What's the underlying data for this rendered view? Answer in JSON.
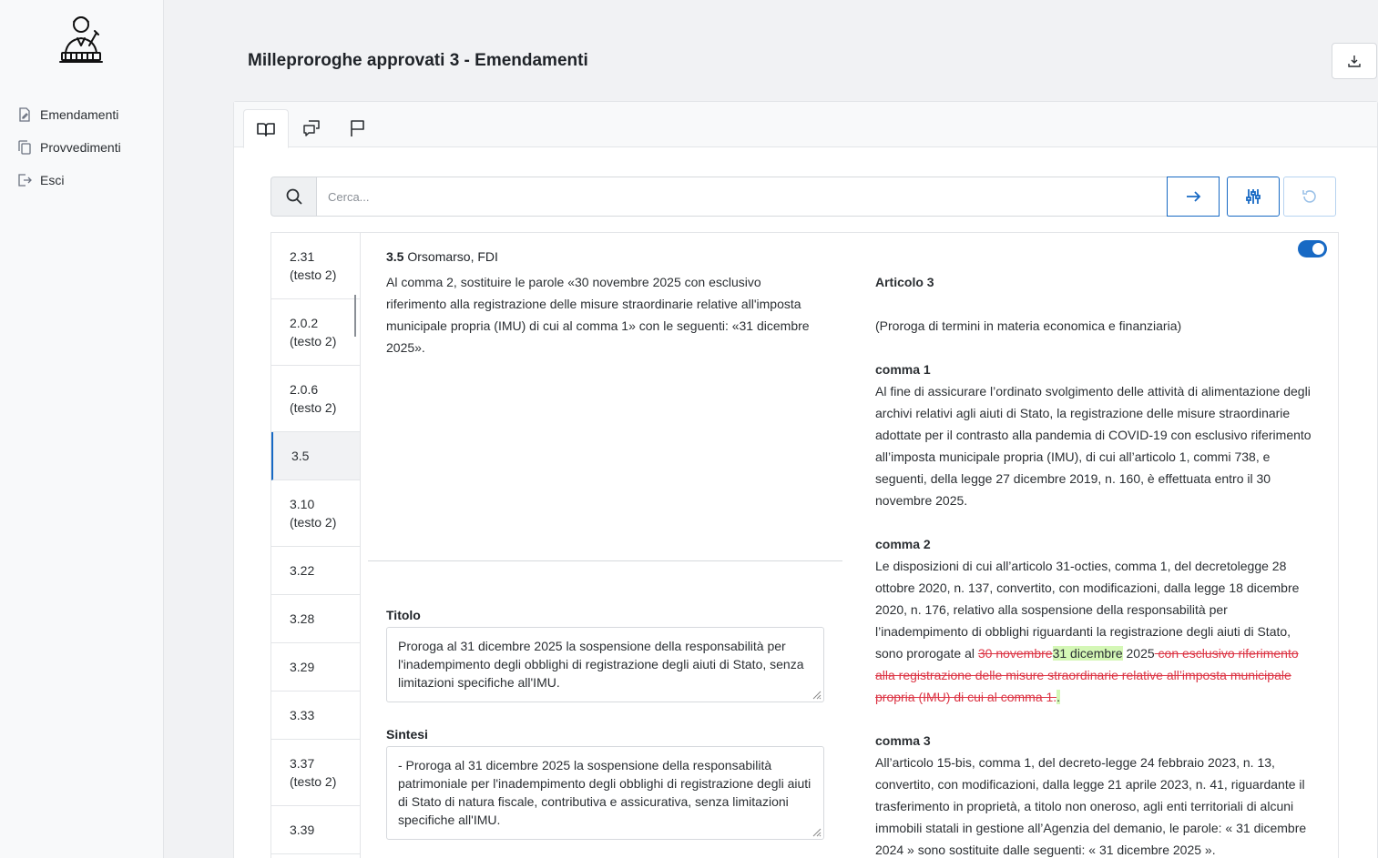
{
  "sidebar": {
    "items": [
      {
        "label": "Emendamenti",
        "icon": "document-edit-icon"
      },
      {
        "label": "Provvedimenti",
        "icon": "documents-copy-icon"
      },
      {
        "label": "Esci",
        "icon": "logout-icon"
      }
    ]
  },
  "header": {
    "title": "Milleproroghe approvati 3 - Emendamenti"
  },
  "tabs": [
    {
      "icon": "book-open-icon",
      "active": true
    },
    {
      "icon": "chat-bubbles-icon",
      "active": false
    },
    {
      "icon": "flag-icon",
      "active": false
    }
  ],
  "search": {
    "placeholder": "Cerca...",
    "value": ""
  },
  "amendments": [
    {
      "code": "2.31",
      "note": "(testo 2)"
    },
    {
      "code": "2.0.2",
      "note": "(testo 2)"
    },
    {
      "code": "2.0.6",
      "note": "(testo 2)"
    },
    {
      "code": "3.5",
      "note": ""
    },
    {
      "code": "3.10",
      "note": "(testo 2)"
    },
    {
      "code": "3.22",
      "note": ""
    },
    {
      "code": "3.28",
      "note": ""
    },
    {
      "code": "3.29",
      "note": ""
    },
    {
      "code": "3.33",
      "note": ""
    },
    {
      "code": "3.37",
      "note": "(testo 2)"
    },
    {
      "code": "3.39",
      "note": ""
    }
  ],
  "selected": {
    "code": "3.5",
    "author": "Orsomarso, FDI",
    "text": "Al comma 2, sostituire le parole «30 novembre 2025 con esclusivo riferimento alla registrazione delle misure straordinarie relative all'imposta municipale propria (IMU) di cui al comma 1» con le seguenti: «31 dicembre 2025».",
    "titolo_label": "Titolo",
    "titolo": "Proroga al 31 dicembre 2025 la sospensione della responsabilità per l'inadempimento degli obblighi di registrazione degli aiuti di Stato, senza limitazioni specifiche all'IMU.",
    "sintesi_label": "Sintesi",
    "sintesi": "- Proroga al 31 dicembre 2025 la sospensione della responsabilità patrimoniale per l'inadempimento degli obblighi di registrazione degli aiuti di Stato di natura fiscale, contributiva e assicurativa, senza limitazioni specifiche all'IMU.",
    "toggle_on": true
  },
  "article": {
    "title": "Articolo 3",
    "subtitle": "(Proroga di termini in materia economica e finanziaria)",
    "comma1_label": "comma 1",
    "comma1": "Al fine di assicurare l’ordinato svolgimento delle attività di alimentazione degli archivi relativi agli aiuti di Stato, la registrazione delle misure straordinarie adottate per il contrasto alla pandemia di COVID-19 con esclusivo riferimento all’imposta municipale propria (IMU), di cui all’articolo 1, commi 738, e seguenti, della legge 27 dicembre 2019, n. 160, è effettuata entro il 30 novembre 2025.",
    "comma2_label": "comma 2",
    "comma2_a": "Le disposizioni di cui all’articolo 31-octies, comma 1, del decretolegge 28 ottobre 2020, n. 137, convertito, con modificazioni, dalla legge 18 dicembre 2020, n. 176, relativo alla sospensione della responsabilità per l’inadempimento di obblighi riguardanti la registrazione degli aiuti di Stato, sono prorogate al ",
    "comma2_del1": "30 novembre",
    "comma2_ins1": "31 dicembre",
    "comma2_b": " 2025",
    "comma2_del2": " con esclusivo riferimento alla registrazione delle misure straordinarie relative all’imposta municipale propria (IMU) di cui al comma 1.",
    "comma2_ins2": ".",
    "comma3_label": "comma 3",
    "comma3": "All’articolo 15-bis, comma 1, del decreto-legge 24 febbraio 2023, n. 13, convertito, con modificazioni, dalla legge 21 aprile 2023, n. 41, riguardante il trasferimento in proprietà, a titolo non oneroso, agli enti territoriali di alcuni immobili statali in gestione all’Agenzia del demanio, le parole: « 31 dicembre 2024 » sono sostituite dalle seguenti: « 31 dicembre 2025 »."
  },
  "colors": {
    "accent": "#1769c4",
    "deletion": "#dc3545",
    "insertion_bg": "#d4f7b6"
  }
}
